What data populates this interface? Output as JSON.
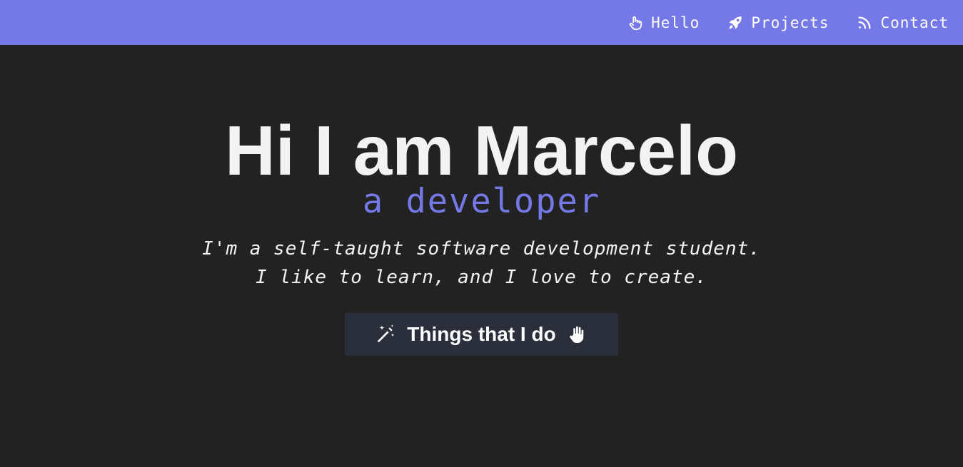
{
  "nav": {
    "items": [
      {
        "label": "Hello",
        "icon": "hand-pointer-icon"
      },
      {
        "label": "Projects",
        "icon": "rocket-icon"
      },
      {
        "label": "Contact",
        "icon": "rss-icon"
      }
    ]
  },
  "hero": {
    "title": "Hi I am Marcelo",
    "subtitle": "a developer",
    "description": [
      "I'm a self-taught software development student.",
      "I like to learn, and I love to create."
    ],
    "cta_label": "Things that I do"
  },
  "colors": {
    "accent": "#7479e7",
    "background": "#222222",
    "button_bg": "#2b2f3b",
    "text": "#f3f3f3"
  }
}
